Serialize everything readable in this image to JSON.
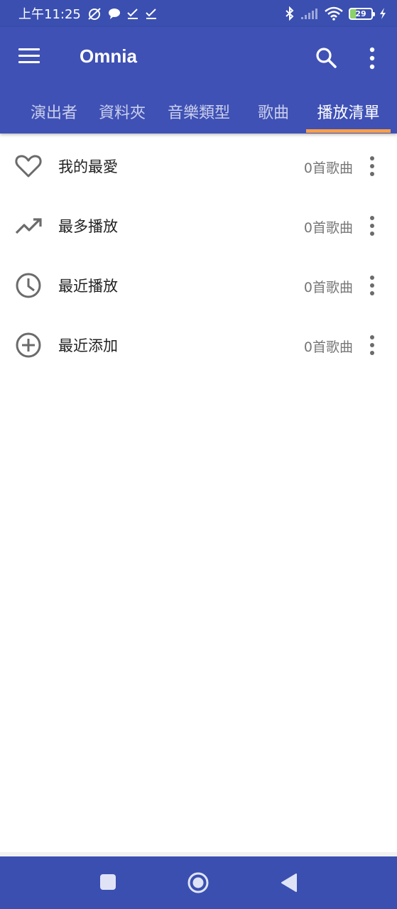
{
  "status_bar": {
    "time": "上午11:25",
    "battery": "29",
    "icons": [
      "silent-alarm-icon",
      "chat-bubble-icon",
      "check-icon",
      "check-icon",
      "bluetooth-icon",
      "signal-icon",
      "wifi-icon",
      "battery-icon",
      "charging-icon"
    ]
  },
  "app_bar": {
    "title": "Omnia",
    "menu_icon": "hamburger-menu-icon",
    "search_icon": "search-icon",
    "more_icon": "more-vert-icon",
    "background": "#3f51b5",
    "indicator_color": "#ff9f43"
  },
  "tabs": [
    {
      "label": "演出者",
      "active": false
    },
    {
      "label": "資料夾",
      "active": false
    },
    {
      "label": "音樂類型",
      "active": false
    },
    {
      "label": "歌曲",
      "active": false
    },
    {
      "label": "播放清單",
      "active": true
    }
  ],
  "playlists": [
    {
      "icon": "heart-icon",
      "label": "我的最愛",
      "count": "0首歌曲"
    },
    {
      "icon": "trending-up-icon",
      "label": "最多播放",
      "count": "0首歌曲"
    },
    {
      "icon": "clock-icon",
      "label": "最近播放",
      "count": "0首歌曲"
    },
    {
      "icon": "add-circle-icon",
      "label": "最近添加",
      "count": "0首歌曲"
    }
  ],
  "nav_bar": {
    "buttons": [
      "recents-square-icon",
      "home-circle-icon",
      "back-triangle-icon"
    ]
  }
}
